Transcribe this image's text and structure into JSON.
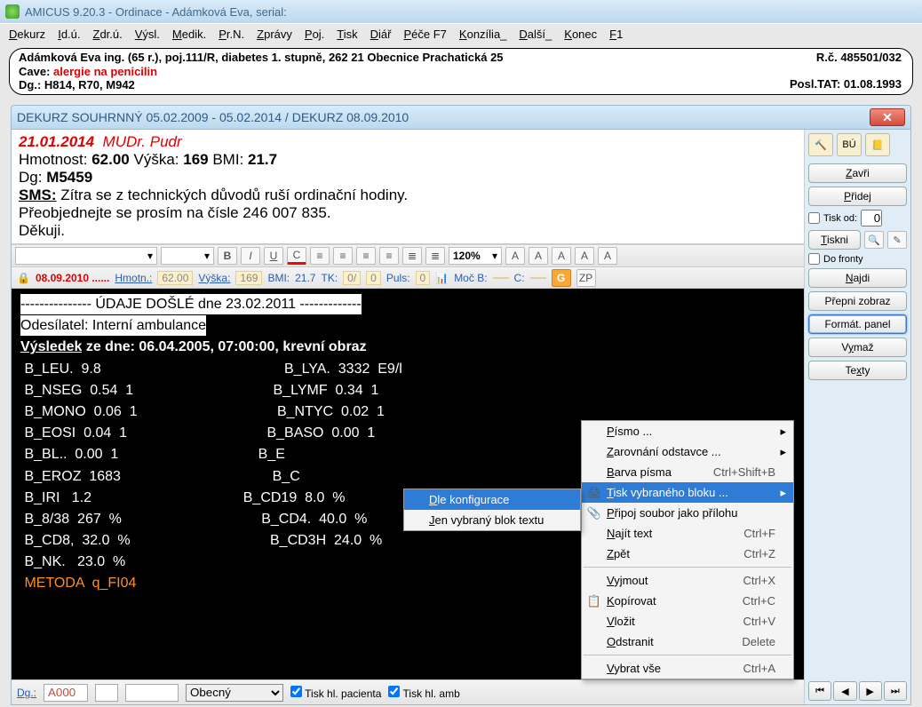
{
  "title": "AMICUS  9.20.3  -   Ordinace  -  Adámková Eva, serial:",
  "menu": [
    "Dekurz",
    "Id.ú.",
    "Zdr.ú.",
    "Výsl.",
    "Medik.",
    "Pr.N.",
    "Zprávy",
    "Poj.",
    "Tisk",
    "Diář",
    "Péče F7",
    "Konzília_",
    "Další_",
    "Konec",
    "F1"
  ],
  "patient": {
    "line1": "Adámková Eva ing. (65 r.), poj.111/R, diabetes 1. stupně,   262 21 Obecnice  Prachatická 25",
    "cave_label": "Cave:",
    "cave_text": "alergie na penicilin",
    "dg": "Dg.: H814, R70, M942",
    "rc": "R.č. 485501/032",
    "posl": "Posl.TAT: 01.08.1993"
  },
  "dek_title": "DEKURZ SOUHRNNÝ 05.02.2009 - 05.02.2014 / DEKURZ 08.09.2010",
  "summary": {
    "date": "21.01.2014",
    "doctor": "MUDr. Pudr",
    "hmot_label": "Hmotnost: ",
    "hmot_val": "62.00",
    "vyska_label": " Výška: ",
    "vyska_val": "169",
    "bmi_label": " BMI: ",
    "bmi_val": "21.7",
    "dg_label": "Dg: ",
    "dg_val": "M5459",
    "sms_label": "SMS:",
    "sms_text": " Zítra se z technických důvodů ruší ordinační hodiny.",
    "sms2": "Přeobjednejte se prosím na čísle 246 007 835.",
    "sms3": "Děkuji."
  },
  "toolbar": {
    "zoom": "120%"
  },
  "info": {
    "date": "08.09.2010 ......",
    "hmotn_l": "Hmotn.:",
    "hmotn_v": "62.00",
    "vyska_l": "Výška:",
    "vyska_v": "169",
    "bmi_l": "BMI:",
    "bmi_v": "21.7",
    "tk_l": "TK:",
    "tk_v1": "0/",
    "tk_v2": "0",
    "puls_l": "Puls:",
    "puls_v": "0",
    "moc_l": "Moč B:",
    "c_l": "C:",
    "zp": "ZP"
  },
  "terminal": {
    "head1": "--------------- ÚDAJE DOŠLÉ dne 23.02.2011 -------------",
    "head2": "Odesílatel: Interní ambulance",
    "vys_a": "Výsledek",
    "vys_b": " ze dne: 06.04.2005, 07:00:00, ",
    "vys_c": "krevní obraz",
    "rows_left": [
      " B_LEU.  9.8             ",
      " B_NSEG  0.54  1  ",
      " B_MONO  0.06  1  ",
      " B_EOSI  0.04  1  ",
      " B_BL..  0.00  1  ",
      " B_EROZ  1683     ",
      " B_IRI   1.2     ",
      " B_8/38  267  %  ",
      " B_CD8,  32.0  %  ",
      " B_NK.   23.0  %  "
    ],
    "rows_right": [
      " B_LYA.  3332  E9/l ",
      " B_LYMF  0.34  1  ",
      " B_NTYC  0.02  1  ",
      " B_BASO  0.00  1  ",
      " B_E",
      " B_C",
      " B_CD19  8.0  %  ",
      " B_CD4.  40.0  %  ",
      " B_CD3H  24.0  %  "
    ],
    "metoda": " METODA  q_FI04"
  },
  "bottom": {
    "dg_l": "Dg.:",
    "dg_v": "A000",
    "dots": ".....  ........",
    "select": "Obecný",
    "chk1": "Tisk hl. pacienta",
    "chk2": "Tisk hl. amb"
  },
  "rpanel": {
    "bu": "BÚ",
    "zavri": "Zavři",
    "pridej": "Přidej",
    "tiskod": "Tisk od:",
    "tiskod_v": "0",
    "tiskni": "Tiskni",
    "dofronty": "Do fronty",
    "najdi": "Najdi",
    "prepni": "Přepni zobraz",
    "format": "Formát. panel",
    "vymaz": "Vymaž",
    "texty": "Texty",
    "pager": [
      "⏮",
      "◀",
      "▶",
      "⏭"
    ]
  },
  "ctx_right": [
    {
      "label": "Písmo ...",
      "arrow": true
    },
    {
      "label": "Zarovnání odstavce ...",
      "arrow": true
    },
    {
      "label": "Barva písma",
      "sc": "Ctrl+Shift+B"
    },
    {
      "label": "Tisk vybraného bloku ...",
      "arrow": true,
      "hl": true,
      "icon": "🖨"
    },
    {
      "label": "Připoj soubor jako přílohu",
      "icon": "📎"
    },
    {
      "label": "Najít text",
      "sc": "Ctrl+F"
    },
    {
      "label": "Zpět",
      "sc": "Ctrl+Z"
    },
    {
      "sep": true
    },
    {
      "label": "Vyjmout",
      "sc": "Ctrl+X"
    },
    {
      "label": "Kopírovat",
      "sc": "Ctrl+C",
      "icon": "📋"
    },
    {
      "label": "Vložit",
      "sc": "Ctrl+V"
    },
    {
      "label": "Odstranit",
      "sc": "Delete"
    },
    {
      "sep": true
    },
    {
      "label": "Vybrat vše",
      "sc": "Ctrl+A"
    }
  ],
  "ctx_sub": [
    {
      "label": "Dle konfigurace",
      "hl": true
    },
    {
      "label": "Jen vybraný blok textu"
    }
  ]
}
